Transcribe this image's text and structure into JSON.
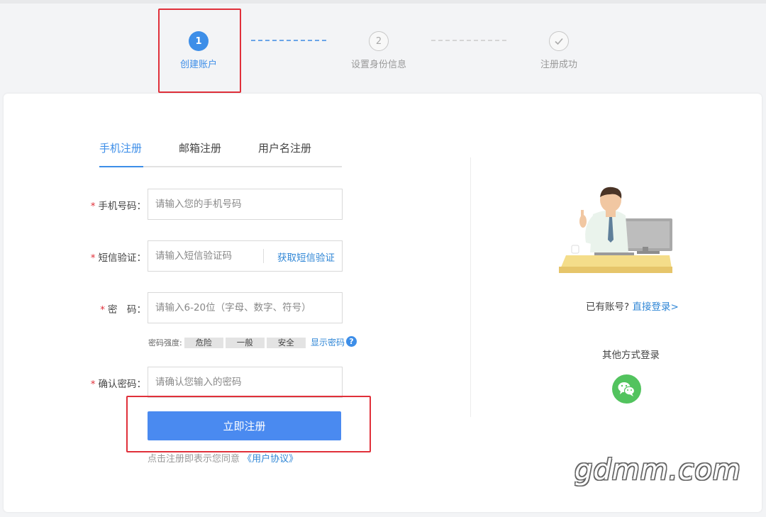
{
  "steps": [
    {
      "number": "1",
      "label": "创建账户",
      "state": "active"
    },
    {
      "number": "2",
      "label": "设置身份信息",
      "state": "todo"
    },
    {
      "number": "",
      "label": "注册成功",
      "state": "todo",
      "icon": "check-icon"
    }
  ],
  "tabs": [
    {
      "label": "手机注册",
      "active": true
    },
    {
      "label": "邮箱注册",
      "active": false
    },
    {
      "label": "用户名注册",
      "active": false
    }
  ],
  "form": {
    "required_mark": "*",
    "phone": {
      "label": "手机号码：",
      "placeholder": "请输入您的手机号码"
    },
    "sms": {
      "label": "短信验证：",
      "placeholder": "请输入短信验证码",
      "get_code": "获取短信验证"
    },
    "password": {
      "label": "密　码：",
      "placeholder": "请输入6-20位（字母、数字、符号）"
    },
    "strength": {
      "label": "密码强度:",
      "levels": [
        "危险",
        "一般",
        "安全"
      ],
      "show_password": "显示密码",
      "help": "?"
    },
    "confirm": {
      "label": "确认密码：",
      "placeholder": "请确认您输入的密码"
    },
    "submit": "立即注册",
    "agree_text": "点击注册即表示您同意",
    "agree_link": "《用户协议》"
  },
  "side": {
    "have_account": "已有账号?",
    "login_link": "直接登录>",
    "other_login": "其他方式登录",
    "wechat_icon": "wechat-icon"
  },
  "colors": {
    "accent": "#3d8ee8",
    "button": "#4a8af0",
    "required": "#e0303a",
    "wechat": "#52c35e",
    "highlight_box": "#e0303a"
  },
  "watermark": "gdmm.com"
}
